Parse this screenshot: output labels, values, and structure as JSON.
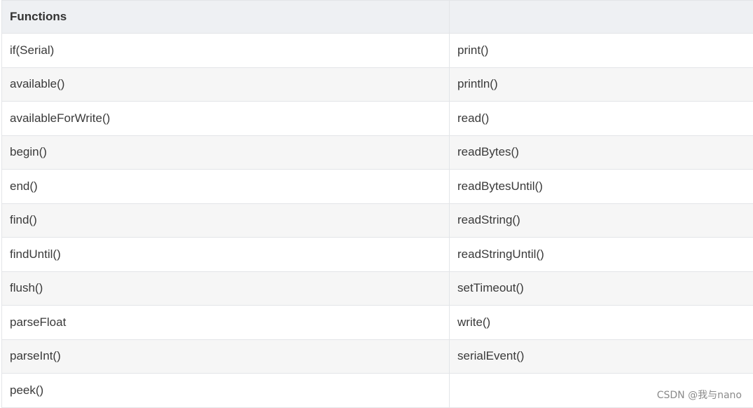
{
  "table": {
    "headers": [
      "Functions",
      ""
    ],
    "rows": [
      [
        "if(Serial)",
        "print()"
      ],
      [
        "available()",
        "println()"
      ],
      [
        "availableForWrite()",
        "read()"
      ],
      [
        "begin()",
        "readBytes()"
      ],
      [
        "end()",
        "readBytesUntil()"
      ],
      [
        "find()",
        "readString()"
      ],
      [
        "findUntil()",
        "readStringUntil()"
      ],
      [
        "flush()",
        "setTimeout()"
      ],
      [
        "parseFloat",
        "write()"
      ],
      [
        "parseInt()",
        "serialEvent()"
      ],
      [
        "peek()",
        ""
      ]
    ]
  },
  "watermark": "CSDN @我与nano"
}
